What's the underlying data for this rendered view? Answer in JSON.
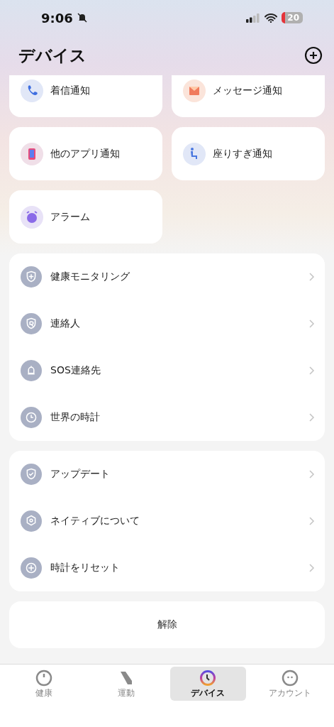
{
  "status_bar": {
    "time": "9:06",
    "battery": "20"
  },
  "header": {
    "title": "デバイス"
  },
  "notification_tiles": [
    {
      "label": "着信通知"
    },
    {
      "label": "メッセージ通知"
    },
    {
      "label": "他のアプリ通知"
    },
    {
      "label": "座りすぎ通知"
    },
    {
      "label": "アラーム"
    }
  ],
  "menu_groups": [
    {
      "items": [
        {
          "label": "健康モニタリング"
        },
        {
          "label": "連絡人"
        },
        {
          "label": "SOS連絡先"
        },
        {
          "label": "世界の時計"
        }
      ]
    },
    {
      "items": [
        {
          "label": "アップデート"
        },
        {
          "label": "ネイティブについて"
        },
        {
          "label": "時計をリセット"
        }
      ]
    }
  ],
  "unpair_button": {
    "label": "解除"
  },
  "tab_bar": [
    {
      "label": "健康",
      "selected": false
    },
    {
      "label": "運動",
      "selected": false
    },
    {
      "label": "デバイス",
      "selected": true
    },
    {
      "label": "アカウント",
      "selected": false
    }
  ]
}
